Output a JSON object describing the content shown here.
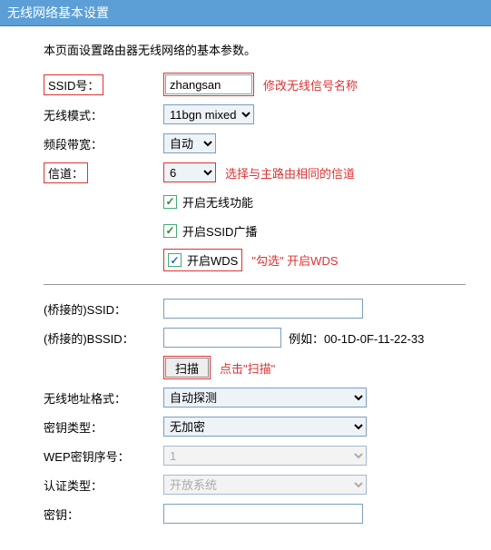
{
  "title": "无线网络基本设置",
  "intro": "本页面设置路由器无线网络的基本参数。",
  "labels": {
    "ssid": "SSID号：",
    "mode": "无线模式：",
    "bandwidth": "频段带宽：",
    "channel": "信道：",
    "enable_wifi": "开启无线功能",
    "enable_ssid_broadcast": "开启SSID广播",
    "enable_wds": "开启WDS",
    "bridge_ssid": "(桥接的)SSID：",
    "bridge_bssid": "(桥接的)BSSID：",
    "scan": "扫描",
    "addr_format": "无线地址格式：",
    "key_type": "密钥类型：",
    "wep_index": "WEP密钥序号：",
    "auth_type": "认证类型：",
    "key": "密钥："
  },
  "values": {
    "ssid": "zhangsan",
    "mode": "11bgn mixed",
    "bandwidth": "自动",
    "channel": "6",
    "bridge_ssid": "",
    "bridge_bssid": "",
    "addr_format": "自动探测",
    "key_type": "无加密",
    "wep_index": "1",
    "auth_type": "开放系统",
    "key": ""
  },
  "annotations": {
    "ssid": "修改无线信号名称",
    "channel": "选择与主路由相同的信道",
    "wds": "\"勾选\" 开启WDS",
    "scan": "点击\"扫描\""
  },
  "example_bssid": "例如：00-1D-0F-11-22-33"
}
